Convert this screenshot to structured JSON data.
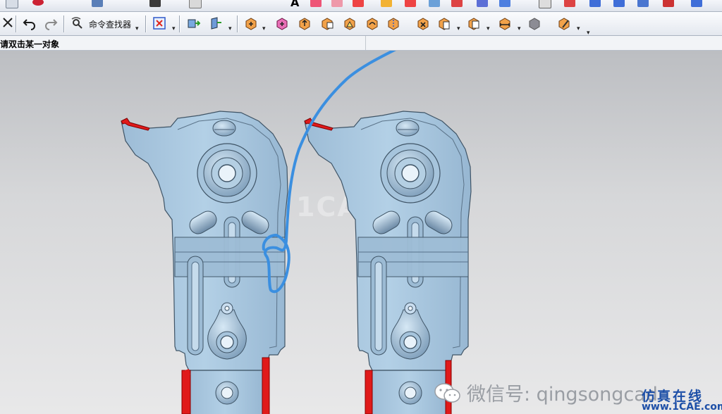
{
  "toolbar": {
    "command_finder_label": "命令查找器",
    "icons": [
      "close-icon",
      "undo-icon",
      "redo-icon",
      "command-finder-icon",
      "selection-filter-icon",
      "move-face-icon",
      "offset-region-icon",
      "delete-face-icon",
      "replace-face-icon",
      "pattern-face-icon",
      "resize-blend-icon",
      "label-chamfer-icon",
      "copy-face-icon",
      "mirror-face-icon",
      "pull-face-icon",
      "resize-face-icon",
      "group-face-icon",
      "remove-face-icon",
      "paste-face-icon",
      "detail-feature-icon",
      "linear-dim-icon",
      "shaded-block-icon",
      "edit-feature-icon"
    ]
  },
  "status": {
    "prompt": "请双击某一对象"
  },
  "viewport": {
    "watermark": "1CAE.COM",
    "wechat_text": "微信号: qingsongcad",
    "brand_cn": "仿真在线",
    "brand_url": "www.1CAE.com"
  },
  "colors": {
    "part_fill": "#a9c8e0",
    "part_edge": "#3f5466",
    "highlight_red": "#e01a1a",
    "annotation_blue": "#3b8fe0"
  }
}
